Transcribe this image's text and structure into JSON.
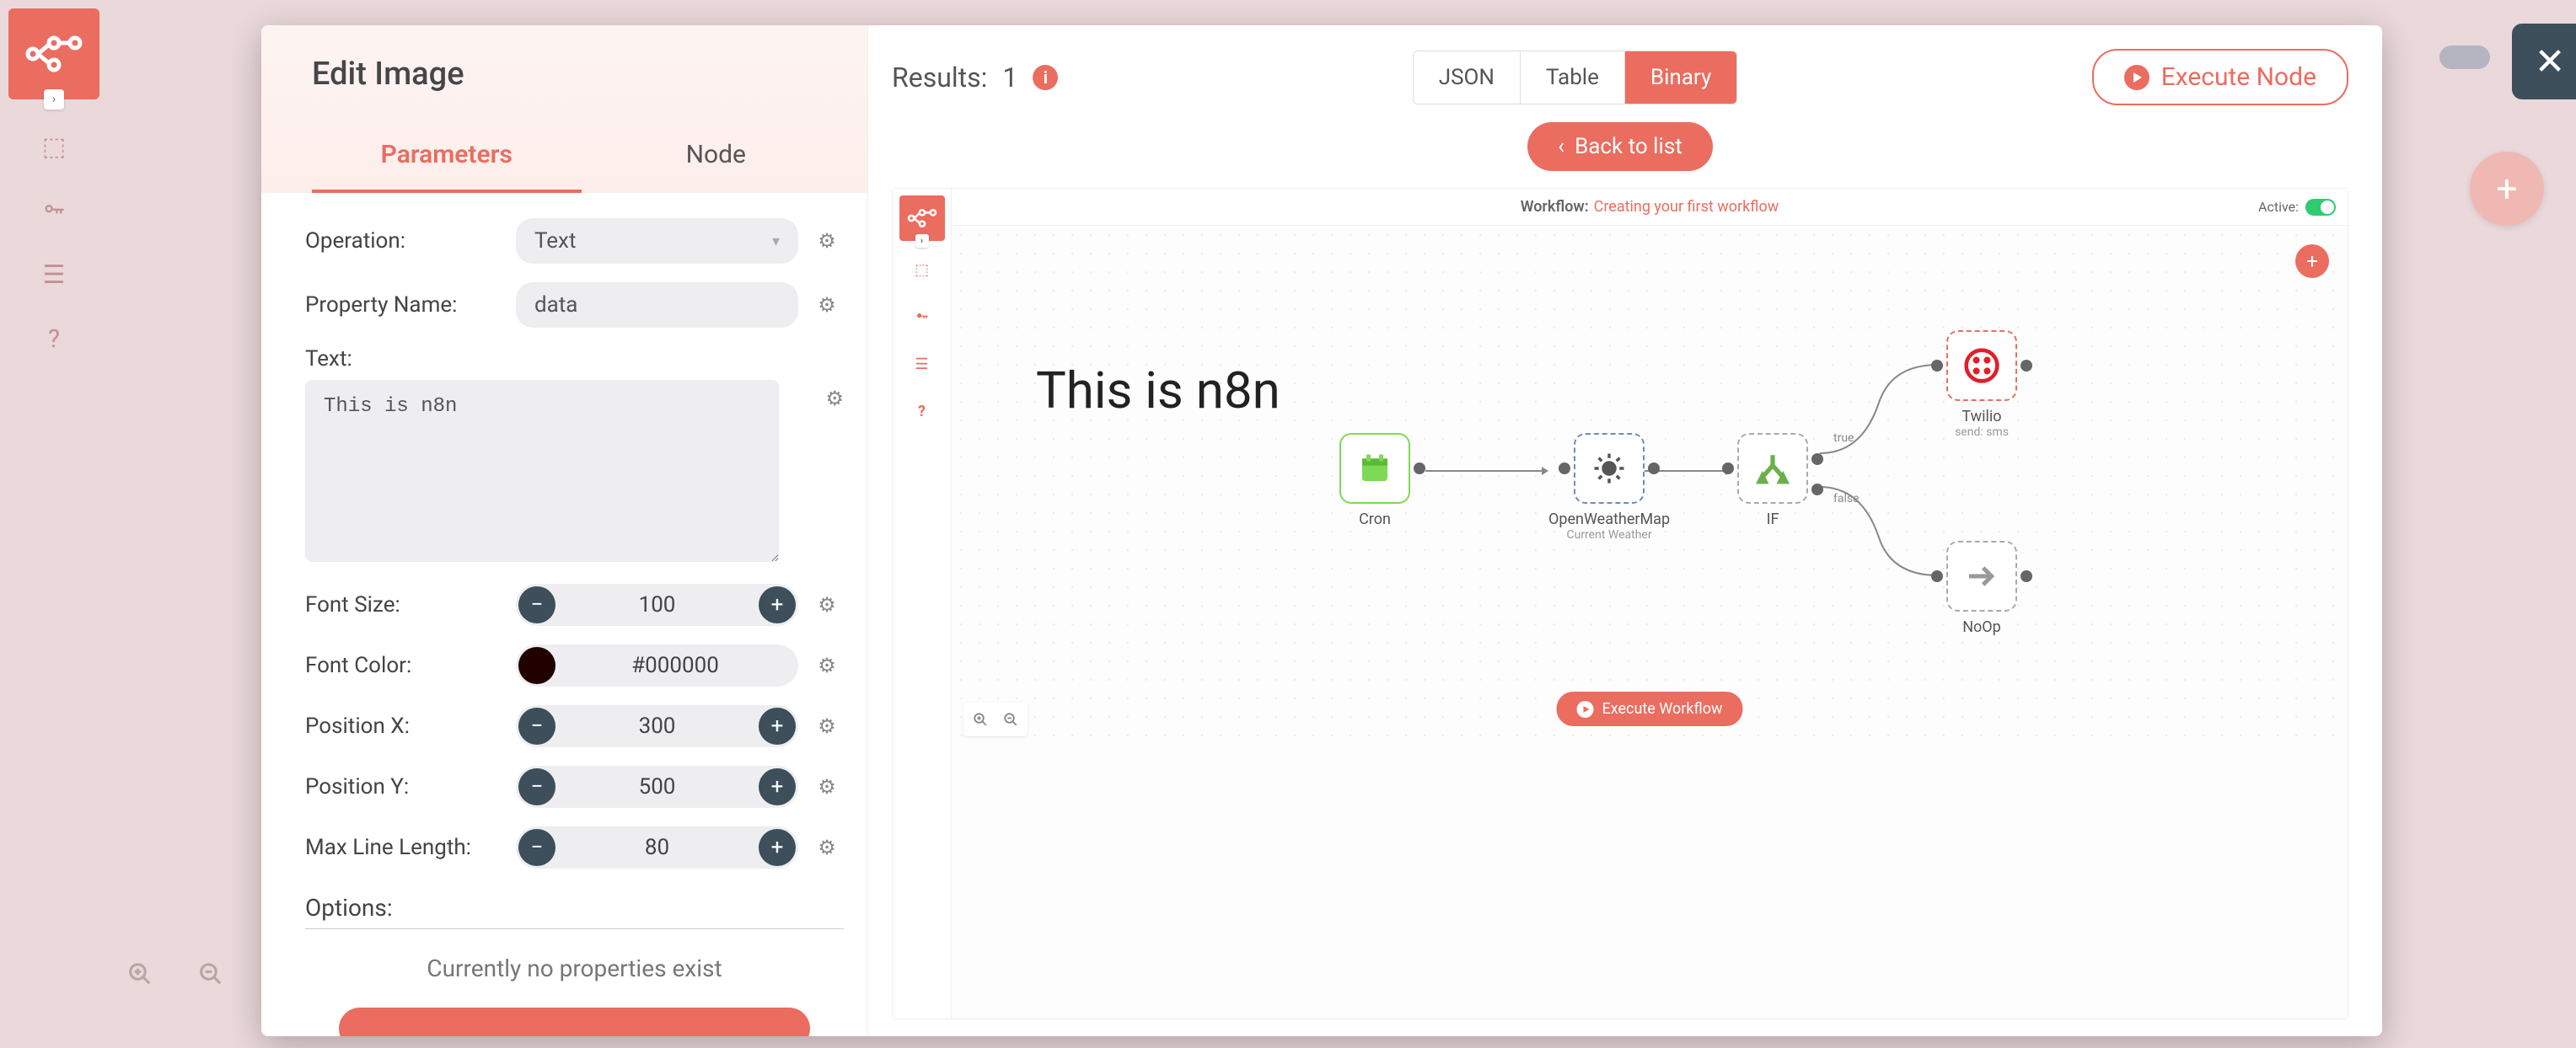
{
  "modal": {
    "title": "Edit Image",
    "tabs": {
      "parameters": "Parameters",
      "node": "Node"
    },
    "params": {
      "operation": {
        "label": "Operation:",
        "value": "Text"
      },
      "property_name": {
        "label": "Property Name:",
        "value": "data"
      },
      "text": {
        "label": "Text:",
        "value": "This is n8n"
      },
      "font_size": {
        "label": "Font Size:",
        "value": "100"
      },
      "font_color": {
        "label": "Font Color:",
        "value": "#000000"
      },
      "position_x": {
        "label": "Position X:",
        "value": "300"
      },
      "position_y": {
        "label": "Position Y:",
        "value": "500"
      },
      "max_line_length": {
        "label": "Max Line Length:",
        "value": "80"
      }
    },
    "options": {
      "label": "Options:",
      "no_props": "Currently no properties exist"
    }
  },
  "right": {
    "results_label": "Results:",
    "results_count": "1",
    "view": {
      "json": "JSON",
      "table": "Table",
      "binary": "Binary"
    },
    "execute_node": "Execute Node",
    "back_to_list": "Back to list"
  },
  "preview": {
    "workflow_label": "Workflow:",
    "workflow_name": "Creating your first workflow",
    "active_label": "Active:",
    "rendered_text": "This is n8n",
    "execute_workflow": "Execute Workflow",
    "nodes": {
      "cron": {
        "label": "Cron"
      },
      "owm": {
        "label": "OpenWeatherMap",
        "sub": "Current Weather"
      },
      "if": {
        "label": "IF",
        "true": "true",
        "false": "false"
      },
      "twilio": {
        "label": "Twilio",
        "sub": "send: sms"
      },
      "noop": {
        "label": "NoOp"
      }
    }
  }
}
